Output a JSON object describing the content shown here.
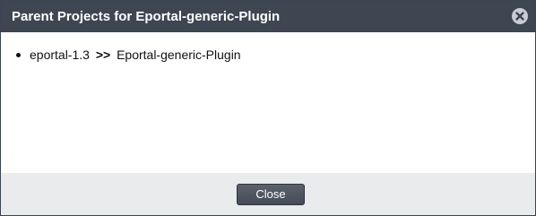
{
  "dialog": {
    "title": "Parent Projects for Eportal-generic-Plugin",
    "close_icon": "close-circle-icon"
  },
  "content": {
    "items": [
      {
        "parent": "eportal-1.3",
        "separator": ">>",
        "child": "Eportal-generic-Plugin"
      }
    ]
  },
  "footer": {
    "close_label": "Close"
  },
  "colors": {
    "titlebar": "#3e4651",
    "footer": "#e9ebed",
    "button": "#4f5761"
  }
}
